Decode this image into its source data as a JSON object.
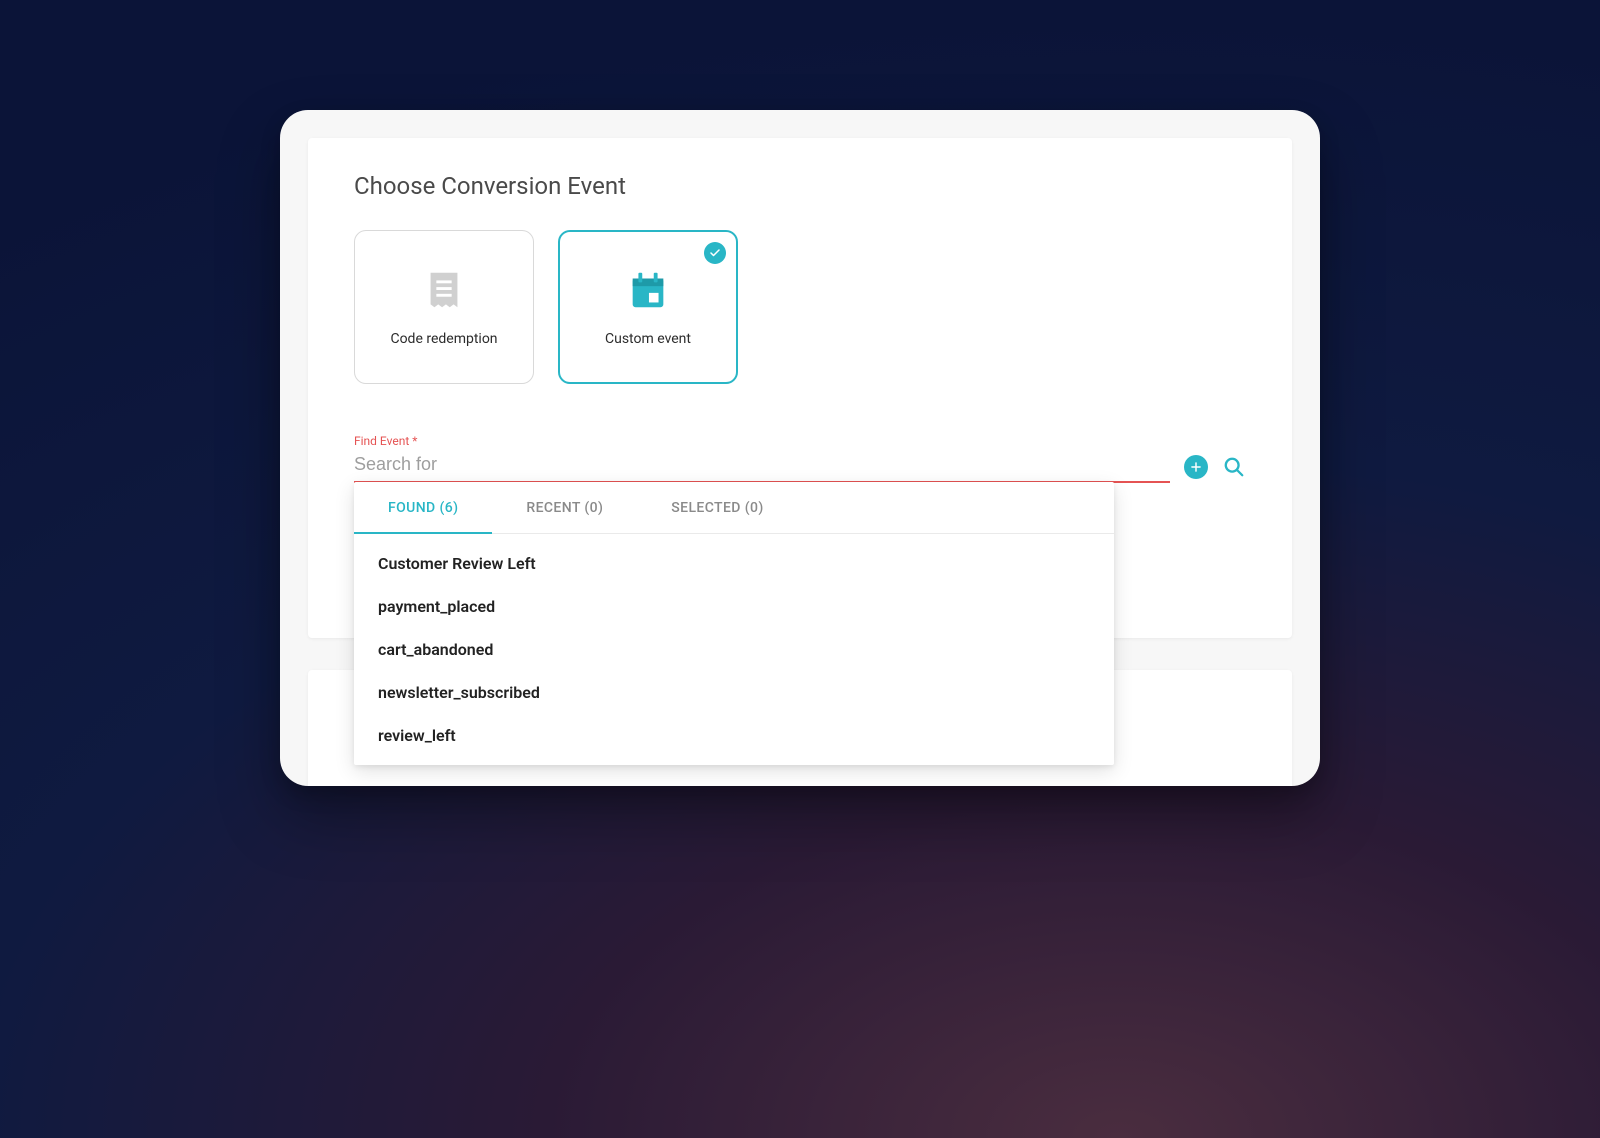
{
  "colors": {
    "accent": "#29b6c6",
    "error": "#e55353"
  },
  "title": "Choose Conversion Event",
  "cards": [
    {
      "label": "Code redemption",
      "icon": "receipt-icon",
      "selected": false
    },
    {
      "label": "Custom event",
      "icon": "calendar-icon",
      "selected": true
    }
  ],
  "search": {
    "label": "Find Event *",
    "placeholder": "Search for",
    "value": ""
  },
  "tabs": [
    {
      "label": "FOUND (6)",
      "active": true
    },
    {
      "label": "RECENT (0)",
      "active": false
    },
    {
      "label": "SELECTED (0)",
      "active": false
    }
  ],
  "results": [
    "Customer Review Left",
    "payment_placed",
    "cart_abandoned",
    "newsletter_subscribed",
    "review_left"
  ]
}
